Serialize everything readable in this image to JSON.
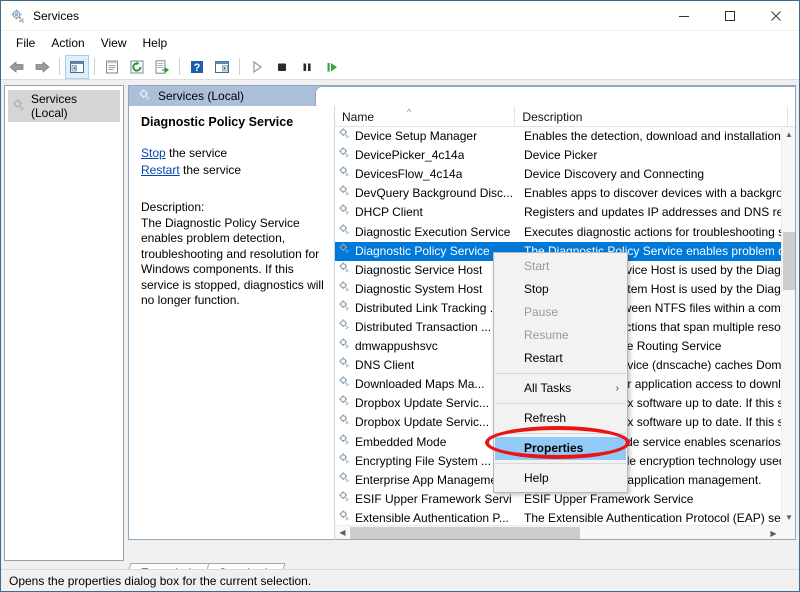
{
  "window": {
    "title": "Services",
    "icon": "services-gear-icon",
    "controls": {
      "minimize": "minimize-icon",
      "maximize": "maximize-icon",
      "close": "close-icon"
    }
  },
  "menubar": {
    "items": [
      "File",
      "Action",
      "View",
      "Help"
    ]
  },
  "toolbar": {
    "buttons": [
      "back-icon",
      "forward-icon",
      "show-hide-console-tree-icon",
      "properties-icon",
      "refresh-icon",
      "export-list-icon",
      "help-icon",
      "show-hide-action-pane-icon",
      "start-service-icon",
      "stop-service-icon",
      "pause-service-icon",
      "restart-service-icon"
    ]
  },
  "tree": {
    "root_label": "Services (Local)",
    "root_icon": "services-gear-icon"
  },
  "pane": {
    "tab_label": "Services (Local)",
    "tab_icon": "services-gear-icon"
  },
  "details": {
    "service_title": "Diagnostic Policy Service",
    "actions": [
      {
        "link": "Stop",
        "suffix": " the service"
      },
      {
        "link": "Restart",
        "suffix": " the service"
      }
    ],
    "description_label": "Description:",
    "description_text": "The Diagnostic Policy Service enables problem detection, troubleshooting and resolution for Windows components.  If this service is stopped, diagnostics will no longer function."
  },
  "list": {
    "columns": [
      "Name",
      "Description"
    ],
    "sort_column": "Name",
    "sort_direction": "ascending",
    "selection_color": "#0078d7",
    "rows": [
      {
        "name": "Device Setup Manager",
        "description": "Enables the detection, download and installation"
      },
      {
        "name": "DevicePicker_4c14a",
        "description": "Device Picker"
      },
      {
        "name": "DevicesFlow_4c14a",
        "description": "Device Discovery and Connecting"
      },
      {
        "name": "DevQuery Background Disc...",
        "description": "Enables apps to discover devices with a backgrou"
      },
      {
        "name": "DHCP Client",
        "description": "Registers and updates IP addresses and DNS recor"
      },
      {
        "name": "Diagnostic Execution Service",
        "description": "Executes diagnostic actions for troubleshooting su"
      },
      {
        "name": "Diagnostic Policy Service",
        "description": "The Diagnostic Policy Service enables problem de",
        "selected": true
      },
      {
        "name": "Diagnostic Service Host",
        "description": "The Diagnostic Service Host is used by the Diagno"
      },
      {
        "name": "Diagnostic System Host",
        "description": "The Diagnostic System Host is used by the Diagno"
      },
      {
        "name": "Distributed Link Tracking ...",
        "description": "Maintains links between NTFS files within a comp"
      },
      {
        "name": "Distributed Transaction ...",
        "description": "Coordinates transactions that span multiple resou"
      },
      {
        "name": "dmwappushsvc",
        "description": "WAP Push Message Routing Service"
      },
      {
        "name": "DNS Client",
        "description": "The DNS Client service (dnscache) caches Domain"
      },
      {
        "name": "Downloaded Maps Ma...",
        "description": "Windows service for application access to downlo"
      },
      {
        "name": "Dropbox Update Servic...",
        "description": "Keeps your Dropbox software up to date. If this se"
      },
      {
        "name": "Dropbox Update Servic...",
        "description": "Keeps your Dropbox software up to date. If this se"
      },
      {
        "name": "Embedded Mode",
        "description": "The Embedded Mode service enables scenarios re"
      },
      {
        "name": "Encrypting File System ...",
        "description": "Provides the core file encryption technology used"
      },
      {
        "name": "Enterprise App Managemen...",
        "description": "Enables enterprise application management."
      },
      {
        "name": "ESIF Upper Framework Servi",
        "description": "ESIF Upper Framework Service"
      },
      {
        "name": "Extensible Authentication P...",
        "description": "The Extensible Authentication Protocol (EAP) serv"
      }
    ]
  },
  "context_menu": {
    "highlight_color": "#91c9f7",
    "annotation_color": "#e81515",
    "items": [
      {
        "label": "Start",
        "enabled": false
      },
      {
        "label": "Stop",
        "enabled": true
      },
      {
        "label": "Pause",
        "enabled": false
      },
      {
        "label": "Resume",
        "enabled": false
      },
      {
        "label": "Restart",
        "enabled": true
      },
      {
        "separator": true
      },
      {
        "label": "All Tasks",
        "enabled": true,
        "submenu": true
      },
      {
        "separator": true
      },
      {
        "label": "Refresh",
        "enabled": true
      },
      {
        "separator": true
      },
      {
        "label": "Properties",
        "enabled": true,
        "highlighted": true,
        "bold": true
      },
      {
        "separator": true
      },
      {
        "label": "Help",
        "enabled": true
      }
    ]
  },
  "bottom_tabs": {
    "tabs": [
      "Extended",
      "Standard"
    ],
    "active": "Standard"
  },
  "statusbar": {
    "text": "Opens the properties dialog box for the current selection."
  }
}
